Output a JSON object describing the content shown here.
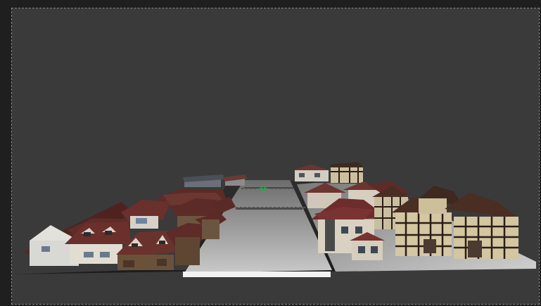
{
  "viewport": {
    "colors": {
      "background": "#3a3a3a",
      "frame": "#1f1f1f",
      "road": "#b9b9b9",
      "roof": "#5a2a28",
      "wall_white": "#d9d6cc",
      "timber": "#2a1e16"
    }
  },
  "scene": {
    "objects": [
      "left-row-houses",
      "right-row-houses",
      "central-road",
      "ground-plane",
      "pivot-gizmo"
    ]
  }
}
